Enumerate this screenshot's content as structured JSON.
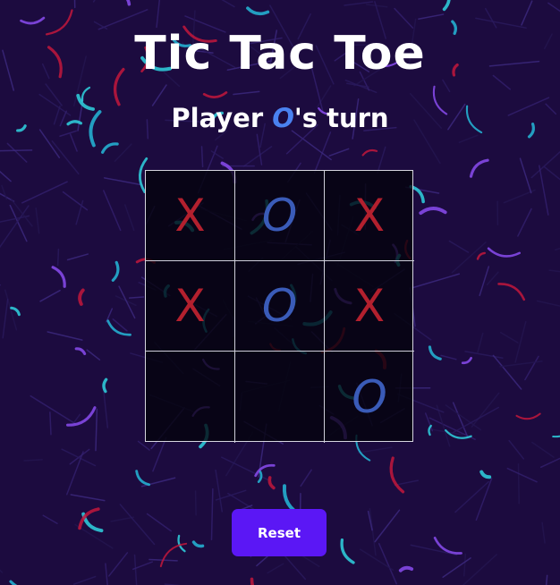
{
  "title": "Tic Tac Toe",
  "status": {
    "prefix": "Player ",
    "player": "O",
    "suffix": "'s turn"
  },
  "board": {
    "cells": [
      "X",
      "O",
      "X",
      "X",
      "O",
      "X",
      "",
      "",
      "O"
    ]
  },
  "reset_label": "Reset",
  "colors": {
    "background": "#1c0b3f",
    "x_mark": "#b3202e",
    "o_mark": "#3a5bb8",
    "status_player": "#4a82f0",
    "reset_button": "#5b17f5"
  }
}
